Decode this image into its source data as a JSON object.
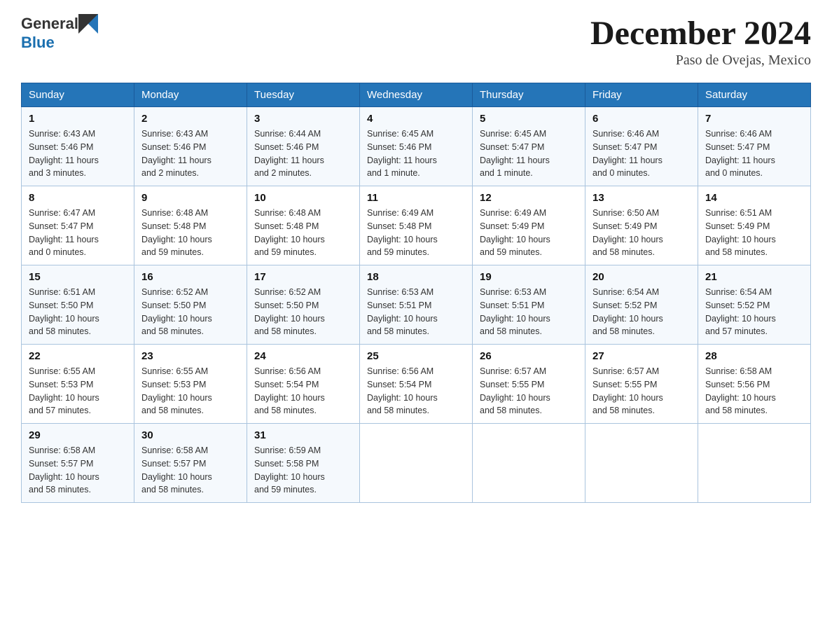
{
  "header": {
    "logo_general": "General",
    "logo_blue": "Blue",
    "month_title": "December 2024",
    "location": "Paso de Ovejas, Mexico"
  },
  "days_of_week": [
    "Sunday",
    "Monday",
    "Tuesday",
    "Wednesday",
    "Thursday",
    "Friday",
    "Saturday"
  ],
  "weeks": [
    [
      {
        "day": "1",
        "info": "Sunrise: 6:43 AM\nSunset: 5:46 PM\nDaylight: 11 hours\nand 3 minutes."
      },
      {
        "day": "2",
        "info": "Sunrise: 6:43 AM\nSunset: 5:46 PM\nDaylight: 11 hours\nand 2 minutes."
      },
      {
        "day": "3",
        "info": "Sunrise: 6:44 AM\nSunset: 5:46 PM\nDaylight: 11 hours\nand 2 minutes."
      },
      {
        "day": "4",
        "info": "Sunrise: 6:45 AM\nSunset: 5:46 PM\nDaylight: 11 hours\nand 1 minute."
      },
      {
        "day": "5",
        "info": "Sunrise: 6:45 AM\nSunset: 5:47 PM\nDaylight: 11 hours\nand 1 minute."
      },
      {
        "day": "6",
        "info": "Sunrise: 6:46 AM\nSunset: 5:47 PM\nDaylight: 11 hours\nand 0 minutes."
      },
      {
        "day": "7",
        "info": "Sunrise: 6:46 AM\nSunset: 5:47 PM\nDaylight: 11 hours\nand 0 minutes."
      }
    ],
    [
      {
        "day": "8",
        "info": "Sunrise: 6:47 AM\nSunset: 5:47 PM\nDaylight: 11 hours\nand 0 minutes."
      },
      {
        "day": "9",
        "info": "Sunrise: 6:48 AM\nSunset: 5:48 PM\nDaylight: 10 hours\nand 59 minutes."
      },
      {
        "day": "10",
        "info": "Sunrise: 6:48 AM\nSunset: 5:48 PM\nDaylight: 10 hours\nand 59 minutes."
      },
      {
        "day": "11",
        "info": "Sunrise: 6:49 AM\nSunset: 5:48 PM\nDaylight: 10 hours\nand 59 minutes."
      },
      {
        "day": "12",
        "info": "Sunrise: 6:49 AM\nSunset: 5:49 PM\nDaylight: 10 hours\nand 59 minutes."
      },
      {
        "day": "13",
        "info": "Sunrise: 6:50 AM\nSunset: 5:49 PM\nDaylight: 10 hours\nand 58 minutes."
      },
      {
        "day": "14",
        "info": "Sunrise: 6:51 AM\nSunset: 5:49 PM\nDaylight: 10 hours\nand 58 minutes."
      }
    ],
    [
      {
        "day": "15",
        "info": "Sunrise: 6:51 AM\nSunset: 5:50 PM\nDaylight: 10 hours\nand 58 minutes."
      },
      {
        "day": "16",
        "info": "Sunrise: 6:52 AM\nSunset: 5:50 PM\nDaylight: 10 hours\nand 58 minutes."
      },
      {
        "day": "17",
        "info": "Sunrise: 6:52 AM\nSunset: 5:50 PM\nDaylight: 10 hours\nand 58 minutes."
      },
      {
        "day": "18",
        "info": "Sunrise: 6:53 AM\nSunset: 5:51 PM\nDaylight: 10 hours\nand 58 minutes."
      },
      {
        "day": "19",
        "info": "Sunrise: 6:53 AM\nSunset: 5:51 PM\nDaylight: 10 hours\nand 58 minutes."
      },
      {
        "day": "20",
        "info": "Sunrise: 6:54 AM\nSunset: 5:52 PM\nDaylight: 10 hours\nand 58 minutes."
      },
      {
        "day": "21",
        "info": "Sunrise: 6:54 AM\nSunset: 5:52 PM\nDaylight: 10 hours\nand 57 minutes."
      }
    ],
    [
      {
        "day": "22",
        "info": "Sunrise: 6:55 AM\nSunset: 5:53 PM\nDaylight: 10 hours\nand 57 minutes."
      },
      {
        "day": "23",
        "info": "Sunrise: 6:55 AM\nSunset: 5:53 PM\nDaylight: 10 hours\nand 58 minutes."
      },
      {
        "day": "24",
        "info": "Sunrise: 6:56 AM\nSunset: 5:54 PM\nDaylight: 10 hours\nand 58 minutes."
      },
      {
        "day": "25",
        "info": "Sunrise: 6:56 AM\nSunset: 5:54 PM\nDaylight: 10 hours\nand 58 minutes."
      },
      {
        "day": "26",
        "info": "Sunrise: 6:57 AM\nSunset: 5:55 PM\nDaylight: 10 hours\nand 58 minutes."
      },
      {
        "day": "27",
        "info": "Sunrise: 6:57 AM\nSunset: 5:55 PM\nDaylight: 10 hours\nand 58 minutes."
      },
      {
        "day": "28",
        "info": "Sunrise: 6:58 AM\nSunset: 5:56 PM\nDaylight: 10 hours\nand 58 minutes."
      }
    ],
    [
      {
        "day": "29",
        "info": "Sunrise: 6:58 AM\nSunset: 5:57 PM\nDaylight: 10 hours\nand 58 minutes."
      },
      {
        "day": "30",
        "info": "Sunrise: 6:58 AM\nSunset: 5:57 PM\nDaylight: 10 hours\nand 58 minutes."
      },
      {
        "day": "31",
        "info": "Sunrise: 6:59 AM\nSunset: 5:58 PM\nDaylight: 10 hours\nand 59 minutes."
      },
      null,
      null,
      null,
      null
    ]
  ]
}
